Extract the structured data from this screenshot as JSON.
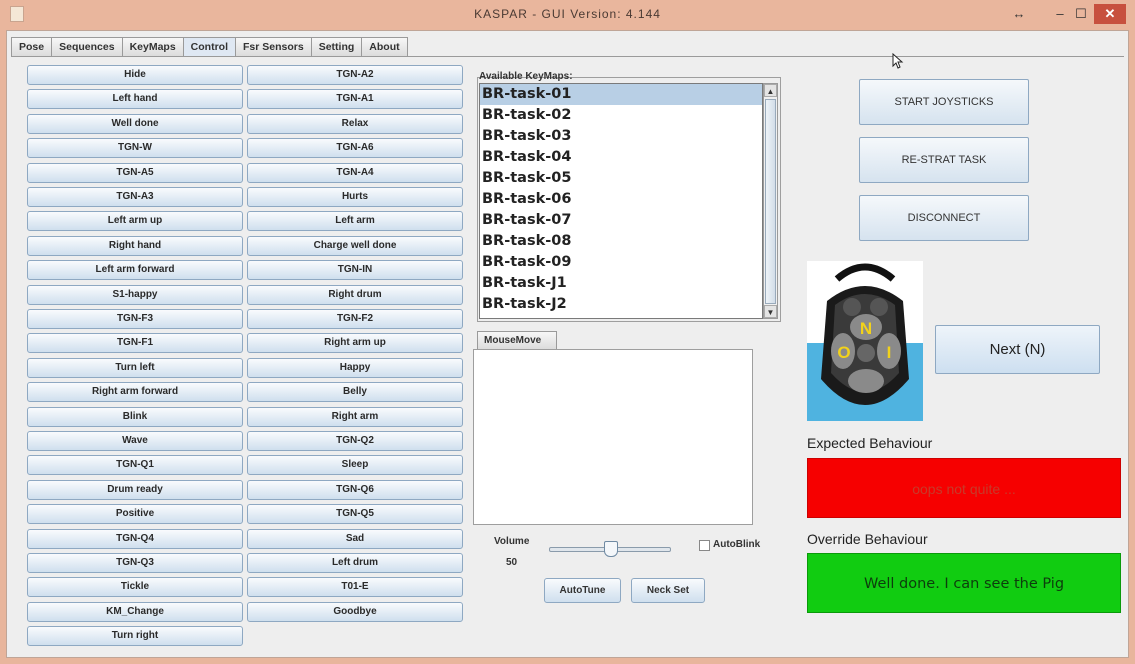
{
  "window": {
    "title": "KASPAR - GUI  Version: 4.144",
    "restore_glyph": "↔",
    "minimize_glyph": "–",
    "maximize_glyph": "☐",
    "close_glyph": "✕"
  },
  "tabs": [
    {
      "label": "Pose"
    },
    {
      "label": "Sequences"
    },
    {
      "label": "KeyMaps"
    },
    {
      "label": "Control",
      "active": true
    },
    {
      "label": "Fsr Sensors"
    },
    {
      "label": "Setting"
    },
    {
      "label": "About"
    }
  ],
  "commands_col1": [
    "Hide",
    "Left hand",
    "Well done",
    "TGN-W",
    "TGN-A5",
    "TGN-A3",
    "Left arm up",
    "Right hand",
    "Left arm forward",
    "S1-happy",
    "TGN-F3",
    "TGN-F1",
    "Turn left",
    "Right arm forward",
    "Blink",
    "Wave",
    "TGN-Q1",
    "Drum ready",
    "Positive",
    "TGN-Q4",
    "TGN-Q3",
    "Tickle",
    "KM_Change",
    "Turn right"
  ],
  "commands_col2": [
    "TGN-A2",
    "TGN-A1",
    "Relax",
    "TGN-A6",
    "TGN-A4",
    "Hurts",
    "Left arm",
    "Charge well done",
    "TGN-IN",
    "Right drum",
    "TGN-F2",
    "Right arm up",
    "Happy",
    "Belly",
    "Right arm",
    "TGN-Q2",
    "Sleep",
    "TGN-Q6",
    "TGN-Q5",
    "Sad",
    "Left drum",
    "T01-E",
    "Goodbye"
  ],
  "keymaps": {
    "label": "Available KeyMaps:",
    "items": [
      "BR-task-01",
      "BR-task-02",
      "BR-task-03",
      "BR-task-04",
      "BR-task-05",
      "BR-task-06",
      "BR-task-07",
      "BR-task-08",
      "BR-task-09",
      "BR-task-J1",
      "BR-task-J2"
    ],
    "selected_index": 0
  },
  "mousemove": {
    "tab_label": "MouseMove"
  },
  "volume": {
    "label": "Volume",
    "value": "50",
    "level": 0.5
  },
  "autoblink": {
    "label": "AutoBlink",
    "checked": false
  },
  "buttons": {
    "autotune": "AutoTune",
    "neck_set": "Neck Set",
    "start_joysticks": "START JOYSTICKS",
    "restart_task": "RE-STRAT TASK",
    "disconnect": "DISCONNECT",
    "next": "Next (N)"
  },
  "remote": {
    "keys": [
      "N",
      "O",
      "I"
    ]
  },
  "expected": {
    "label": "Expected Behaviour",
    "text": "oops not quite ...",
    "color": "#f60000"
  },
  "override": {
    "label": "Override Behaviour",
    "text": "Well done. I can see the Pig",
    "color": "#11cc11"
  }
}
